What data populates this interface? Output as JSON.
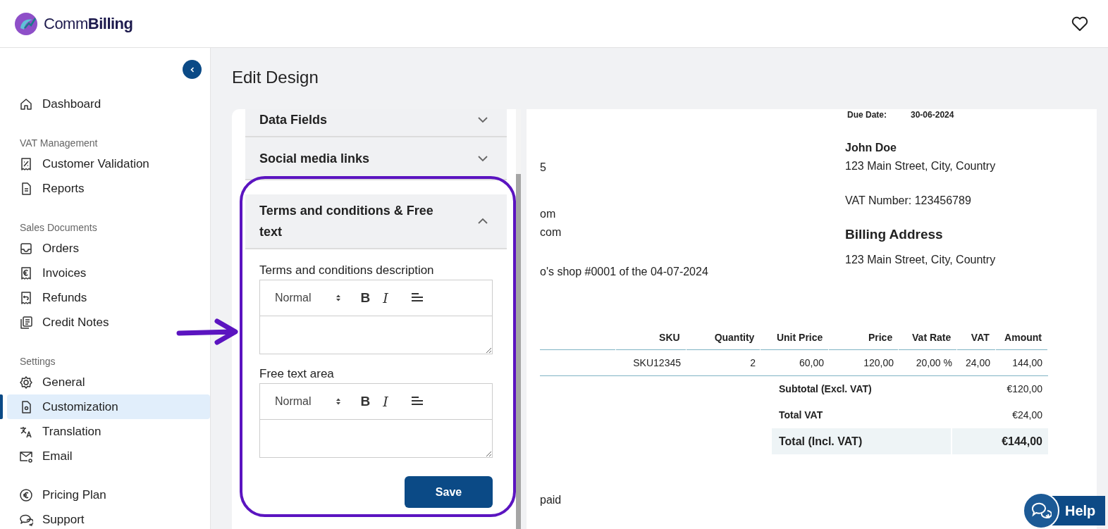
{
  "header": {
    "logo_text_light": "Comm",
    "logo_text_bold": "Billing"
  },
  "sidebar": {
    "sections": [
      {
        "items": [
          {
            "label": "Dashboard",
            "selected": false
          }
        ]
      },
      {
        "heading": "VAT Management",
        "items": [
          {
            "label": "Customer Validation",
            "selected": false
          },
          {
            "label": "Reports",
            "selected": false
          }
        ]
      },
      {
        "heading": "Sales Documents",
        "items": [
          {
            "label": "Orders",
            "selected": false
          },
          {
            "label": "Invoices",
            "selected": false
          },
          {
            "label": "Refunds",
            "selected": false
          },
          {
            "label": "Credit Notes",
            "selected": false
          }
        ]
      },
      {
        "heading": "Settings",
        "items": [
          {
            "label": "General",
            "selected": false
          },
          {
            "label": "Customization",
            "selected": true
          },
          {
            "label": "Translation",
            "selected": false
          },
          {
            "label": "Email",
            "selected": false
          }
        ]
      },
      {
        "items": [
          {
            "label": "Pricing Plan",
            "selected": false
          },
          {
            "label": "Support",
            "selected": false
          }
        ]
      }
    ]
  },
  "page_title": "Edit Design",
  "accordion": [
    {
      "title": "Data Fields",
      "expanded": false
    },
    {
      "title": "Social media links",
      "expanded": false
    },
    {
      "title": "Terms and conditions & Free text",
      "expanded": true,
      "fields": [
        {
          "label": "Terms and conditions description",
          "format": "Normal",
          "tools": [
            {
              "kind": "bold",
              "glyph": "B"
            },
            {
              "kind": "italic",
              "glyph": "I"
            },
            {
              "kind": "align"
            }
          ]
        },
        {
          "label": "Free text area",
          "format": "Normal",
          "tools": [
            {
              "kind": "bold",
              "glyph": "B"
            },
            {
              "kind": "italic",
              "glyph": "I"
            },
            {
              "kind": "align"
            }
          ]
        }
      ],
      "button": "Save"
    }
  ],
  "preview": {
    "due_label": "Due Date:",
    "due_value": "30-06-2024",
    "left_fragments": [
      "5",
      "om",
      "com",
      "o's shop #0001 of the 04-07-2024"
    ],
    "customer": {
      "name": "John Doe",
      "address": "123 Main Street, City, Country",
      "vat": "VAT Number: 123456789"
    },
    "billing": {
      "heading": "Billing Address",
      "address": "123 Main Street, City, Country"
    },
    "table": {
      "columns": [
        "",
        "SKU",
        "Quantity",
        "Unit Price",
        "Price",
        "Vat Rate",
        "VAT",
        "Amount"
      ],
      "rows": [
        [
          "",
          "SKU12345",
          "2",
          "60,00",
          "120,00",
          "20,00 %",
          "24,00",
          "144,00"
        ]
      ]
    },
    "totals": [
      {
        "label": "Subtotal (Excl. VAT)",
        "value": "€120,00",
        "highlighted": false
      },
      {
        "label": "Total VAT",
        "value": "€24,00",
        "highlighted": false
      },
      {
        "label": "Total (Incl. VAT)",
        "value": "€144,00",
        "highlighted": true
      }
    ],
    "footer_fragment": "paid"
  },
  "help": {
    "label": "Help"
  }
}
